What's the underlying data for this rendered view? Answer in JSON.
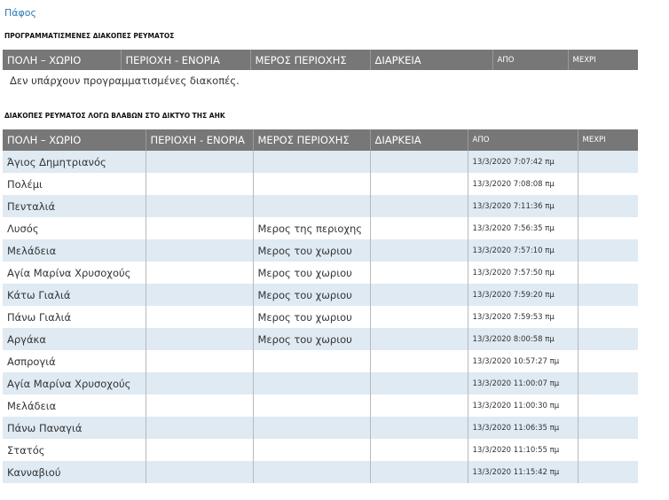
{
  "region": "Πάφος",
  "planned": {
    "heading": "ΠΡΟΓΡΑΜΜΑΤΙΣΜΕΝΕΣ ΔΙΑΚΟΠΕΣ ΡΕΥΜΑΤΟΣ",
    "columns": [
      "ΠΟΛΗ – ΧΩΡΙΟ",
      "ΠΕΡΙΟΧΗ - ΕΝΟΡΙΑ",
      "ΜΕΡΟΣ ΠΕΡΙΟΧΗΣ",
      "ΔΙΑΡΚΕΙΑ",
      "ΑΠΟ",
      "ΜΕΧΡΙ"
    ],
    "empty_message": "Δεν υπάρχουν προγραμματισμένες διακοπές."
  },
  "damage": {
    "heading": "ΔΙΑΚΟΠΕΣ ΡΕΥΜΑΤΟΣ ΛΟΓΩ ΒΛΑΒΩΝ ΣΤΟ ΔΙΚΤΥΟ ΤΗΣ ΑΗΚ",
    "columns": [
      "ΠΟΛΗ – ΧΩΡΙΟ",
      "ΠΕΡΙΟΧΗ - ΕΝΟΡΙΑ",
      "ΜΕΡΟΣ ΠΕΡΙΟΧΗΣ",
      "ΔΙΑΡΚΕΙΑ",
      "ΑΠΟ",
      "ΜΕΧΡΙ"
    ],
    "rows": [
      [
        "Άγιος Δημητριανός",
        "",
        "",
        "",
        "13/3/2020 7:07:42 πμ",
        ""
      ],
      [
        "Πολέμι",
        "",
        "",
        "",
        "13/3/2020 7:08:08 πμ",
        ""
      ],
      [
        "Πενταλιά",
        "",
        "",
        "",
        "13/3/2020 7:11:36 πμ",
        ""
      ],
      [
        "Λυσός",
        "",
        "Μερος της περιοχης",
        "",
        "13/3/2020 7:56:35 πμ",
        ""
      ],
      [
        "Μελάδεια",
        "",
        "Μερος του χωριου",
        "",
        "13/3/2020 7:57:10 πμ",
        ""
      ],
      [
        "Αγία Μαρίνα Χρυσοχούς",
        "",
        "Μερος του χωριου",
        "",
        "13/3/2020 7:57:50 πμ",
        ""
      ],
      [
        "Κάτω Γιαλιά",
        "",
        "Μερος του χωριου",
        "",
        "13/3/2020 7:59:20 πμ",
        ""
      ],
      [
        "Πάνω Γιαλιά",
        "",
        "Μερος του χωριου",
        "",
        "13/3/2020 7:59:53 πμ",
        ""
      ],
      [
        "Αργάκα",
        "",
        "Μερος του χωριου",
        "",
        "13/3/2020 8:00:58 πμ",
        ""
      ],
      [
        "Ασπρογιά",
        "",
        "",
        "",
        "13/3/2020 10:57:27 πμ",
        ""
      ],
      [
        "Αγία Μαρίνα Χρυσοχούς",
        "",
        "",
        "",
        "13/3/2020 11:00:07 πμ",
        ""
      ],
      [
        "Μελάδεια",
        "",
        "",
        "",
        "13/3/2020 11:00:30 πμ",
        ""
      ],
      [
        "Πάνω Παναγιά",
        "",
        "",
        "",
        "13/3/2020 11:06:35 πμ",
        ""
      ],
      [
        "Στατός",
        "",
        "",
        "",
        "13/3/2020 11:10:55 πμ",
        ""
      ],
      [
        "Κανναβιού",
        "",
        "",
        "",
        "13/3/2020 11:15:42 πμ",
        ""
      ]
    ]
  }
}
